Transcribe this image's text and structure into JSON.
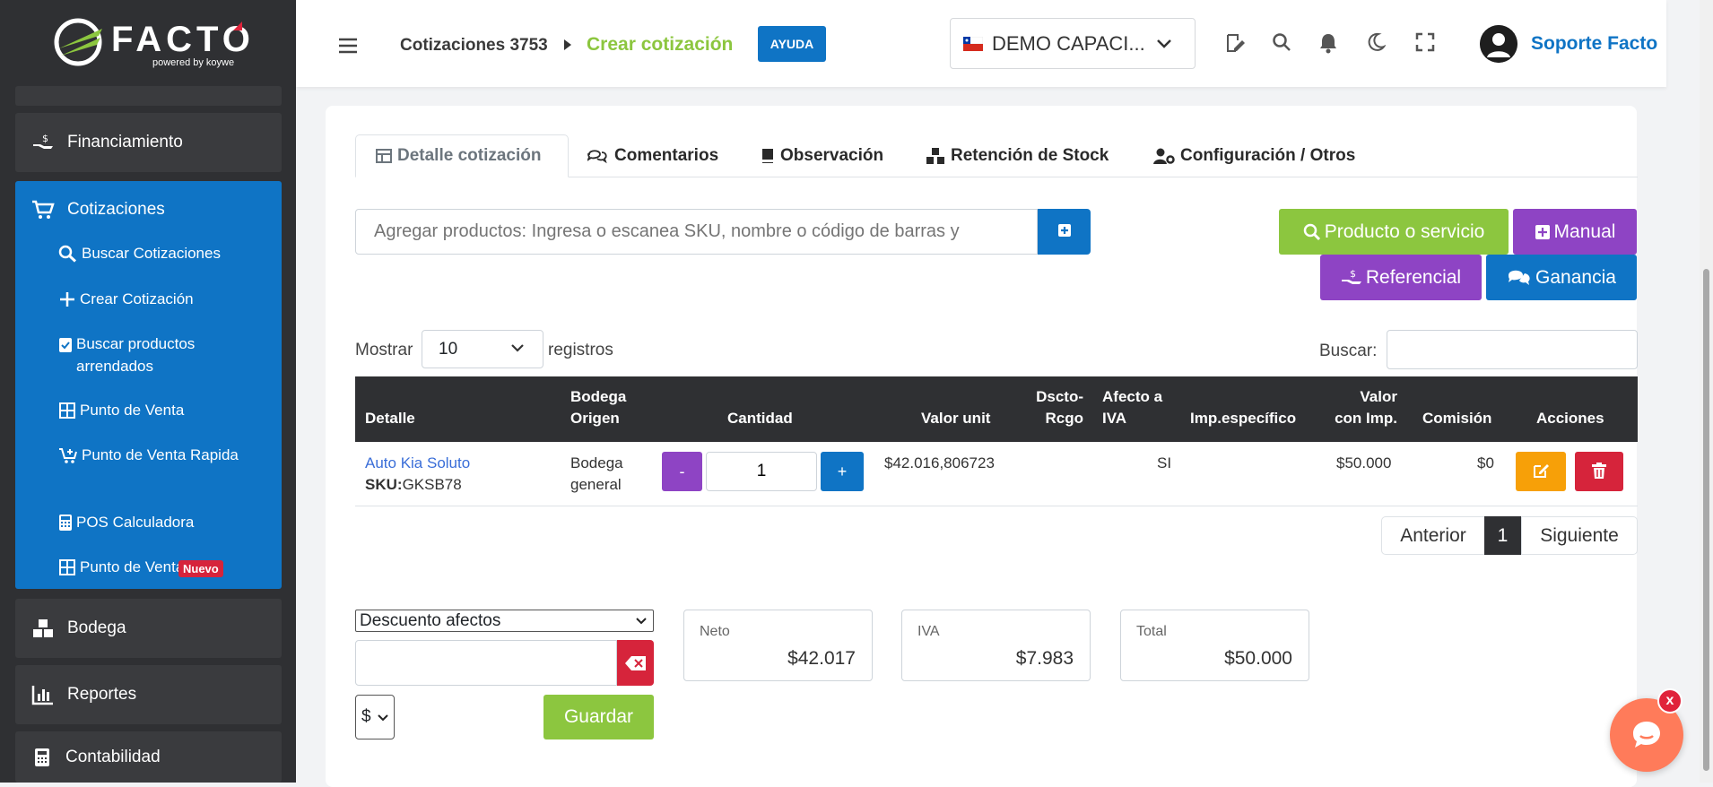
{
  "sidebar": {
    "logo_text": "FACTO",
    "logo_sub": "powered by koywe",
    "items": [
      {
        "label": "Financiamiento"
      },
      {
        "label": "Cotizaciones"
      },
      {
        "label": "Bodega"
      },
      {
        "label": "Reportes"
      },
      {
        "label": "Contabilidad"
      }
    ],
    "sub_items": [
      {
        "label": "Buscar Cotizaciones"
      },
      {
        "label": "Crear Cotización"
      },
      {
        "label": "Buscar productos arrendados"
      },
      {
        "label": "Punto de Venta"
      },
      {
        "label": "Punto de Venta Rapida"
      },
      {
        "label": "POS Calculadora"
      },
      {
        "label": "Punto de Venta"
      }
    ],
    "new_badge": "Nuevo"
  },
  "header": {
    "breadcrumb_parent": "Cotizaciones 3753",
    "breadcrumb_current": "Crear cotización",
    "help_label": "AYUDA",
    "company": "DEMO CAPACI...",
    "user_name": "Soporte Facto"
  },
  "tabs": [
    {
      "label": "Detalle cotización"
    },
    {
      "label": "Comentarios"
    },
    {
      "label": "Observación"
    },
    {
      "label": "Retención de Stock"
    },
    {
      "label": "Configuración / Otros"
    }
  ],
  "add_product": {
    "placeholder": "Agregar productos: Ingresa o escanea SKU, nombre o código de barras y"
  },
  "actions": {
    "producto": "Producto o servicio",
    "manual": "Manual",
    "referencial": "Referencial",
    "ganancia": "Ganancia"
  },
  "table_controls": {
    "show_label": "Mostrar",
    "page_size": "10",
    "records_label": "registros",
    "search_label": "Buscar:"
  },
  "table": {
    "headers": [
      "Detalle",
      "Bodega Origen",
      "Cantidad",
      "Valor unit",
      "Dscto-Rcgo",
      "Afecto a IVA",
      "Imp.específico",
      "Valor con Imp.",
      "Comisión",
      "Acciones"
    ],
    "header_lines": {
      "bodega": [
        "Bodega",
        "Origen"
      ],
      "dscto": [
        "Dscto-",
        "Rcgo"
      ],
      "afecto": [
        "Afecto a",
        "IVA"
      ],
      "valor_imp": [
        "Valor",
        "con Imp."
      ]
    },
    "rows": [
      {
        "product": "Auto Kia Soluto",
        "sku_label": "SKU:",
        "sku": "GKSB78",
        "bodega": [
          "Bodega",
          "general"
        ],
        "qty_minus": "-",
        "qty": "1",
        "qty_plus": "+",
        "valor_unit": "$42.016,806723",
        "afecto": "SI",
        "valor_imp": "$50.000",
        "comision": "$0"
      }
    ]
  },
  "pagination": {
    "prev": "Anterior",
    "current": "1",
    "next": "Siguiente"
  },
  "discount": {
    "type": "Descuento afectos",
    "currency": "$",
    "save": "Guardar"
  },
  "totals": {
    "neto_label": "Neto",
    "neto": "$42.017",
    "iva_label": "IVA",
    "iva": "$7.983",
    "total_label": "Total",
    "total": "$50.000"
  },
  "chat": {
    "close": "x"
  },
  "colors": {
    "primary": "#0f74c5",
    "green": "#8cc63f",
    "purple": "#8e44c4",
    "danger": "#d6243b",
    "warning": "#f7a008",
    "dark": "#2f3033"
  }
}
